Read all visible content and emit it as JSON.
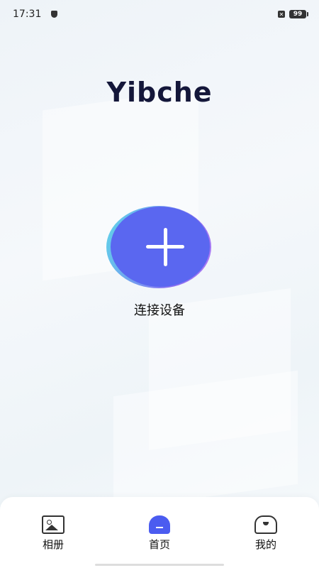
{
  "status_bar": {
    "time": "17:31",
    "battery": "99"
  },
  "brand": {
    "logo_text": "Yibche"
  },
  "main": {
    "connect_label": "连接设备"
  },
  "tabbar": {
    "items": [
      {
        "label": "相册",
        "icon": "album-icon"
      },
      {
        "label": "首页",
        "icon": "home-icon",
        "active": true
      },
      {
        "label": "我的",
        "icon": "profile-icon"
      }
    ]
  },
  "colors": {
    "accent": "#5a67f0",
    "active_tab": "#4b5cf0",
    "logo": "#14173a"
  }
}
